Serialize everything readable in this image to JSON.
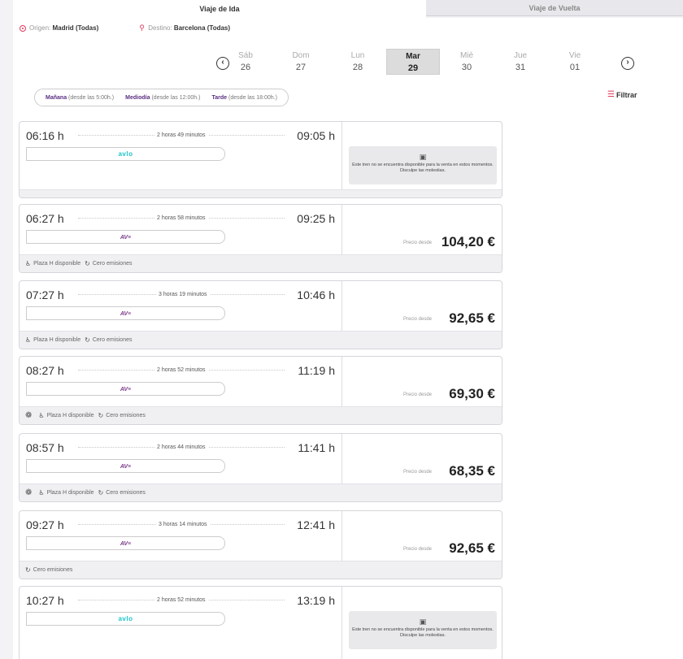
{
  "tabs": {
    "outbound": "Viaje de Ida",
    "return": "Viaje de Vuelta"
  },
  "route": {
    "origin_label": "Origen:",
    "origin_value": "Madrid",
    "origin_suffix": "(Todas)",
    "dest_label": "Destino:",
    "dest_value": "Barcelona",
    "dest_suffix": "(Todas)"
  },
  "days": [
    {
      "name": "Sáb",
      "num": "26"
    },
    {
      "name": "Dom",
      "num": "27"
    },
    {
      "name": "Lun",
      "num": "28"
    },
    {
      "name": "Mar",
      "num": "29",
      "active": true
    },
    {
      "name": "Mié",
      "num": "30"
    },
    {
      "name": "Jue",
      "num": "31"
    },
    {
      "name": "Vie",
      "num": "01"
    }
  ],
  "time_filter": {
    "morning": "Mañana",
    "morning_hint": "(desde las 5:00h.)",
    "midday": "Mediodía",
    "midday_hint": "(desde las 12:00h.)",
    "evening": "Tarde",
    "evening_hint": "(desde las 18:00h.)"
  },
  "filter_label": "Filtrar",
  "price_from": "Precio desde",
  "unavailable_text": "Este tren no se encuentra disponible para la venta en estos momentos. Disculpe las molestias.",
  "features": {
    "plaza_h": "Plaza H disponible",
    "zero": "Cero emisiones"
  },
  "trains": [
    {
      "dep": "06:16 h",
      "arr": "09:05 h",
      "dur": "2 horas 49 minutos",
      "brand": "avlo",
      "available": false,
      "price": "",
      "pet": false,
      "plaza_h": false,
      "zero": false
    },
    {
      "dep": "06:27 h",
      "arr": "09:25 h",
      "dur": "2 horas 58 minutos",
      "brand": "AVE",
      "available": true,
      "price": "104,20 €",
      "pet": false,
      "plaza_h": true,
      "zero": true
    },
    {
      "dep": "07:27 h",
      "arr": "10:46 h",
      "dur": "3 horas 19 minutos",
      "brand": "AVE",
      "available": true,
      "price": "92,65 €",
      "pet": false,
      "plaza_h": true,
      "zero": true
    },
    {
      "dep": "08:27 h",
      "arr": "11:19 h",
      "dur": "2 horas 52 minutos",
      "brand": "AVE",
      "available": true,
      "price": "69,30 €",
      "pet": true,
      "plaza_h": true,
      "zero": true
    },
    {
      "dep": "08:57 h",
      "arr": "11:41 h",
      "dur": "2 horas 44 minutos",
      "brand": "AVE",
      "available": true,
      "price": "68,35 €",
      "pet": true,
      "plaza_h": true,
      "zero": true
    },
    {
      "dep": "09:27 h",
      "arr": "12:41 h",
      "dur": "3 horas 14 minutos",
      "brand": "AVE",
      "available": true,
      "price": "92,65 €",
      "pet": false,
      "plaza_h": false,
      "zero": true
    },
    {
      "dep": "10:27 h",
      "arr": "13:19 h",
      "dur": "2 horas 52 minutos",
      "brand": "avlo",
      "available": false,
      "price": "",
      "pet": false,
      "plaza_h": false,
      "zero": false
    }
  ]
}
